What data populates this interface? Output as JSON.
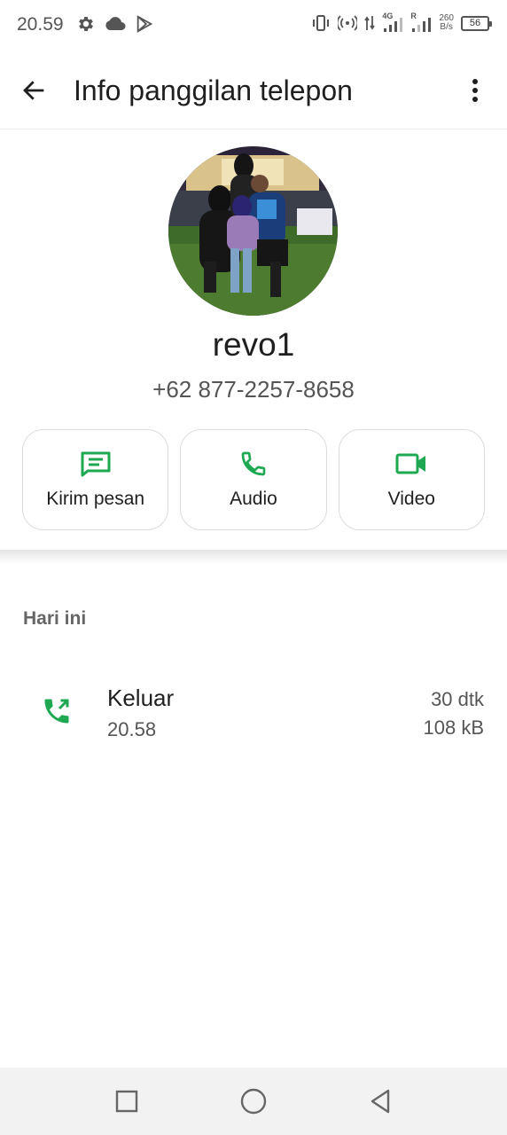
{
  "status_bar": {
    "time": "20.59",
    "network_type": "4G",
    "roaming": "R",
    "net_speed_value": "260",
    "net_speed_unit": "B/s",
    "battery": "56"
  },
  "app_bar": {
    "title": "Info panggilan telepon",
    "back_icon": "arrow-left-icon",
    "menu_icon": "more-vert-icon"
  },
  "contact": {
    "name": "revo1",
    "phone": "+62 877-2257-8658"
  },
  "actions": [
    {
      "label": "Kirim pesan",
      "icon": "message-icon"
    },
    {
      "label": "Audio",
      "icon": "phone-icon"
    },
    {
      "label": "Video",
      "icon": "videocam-icon"
    }
  ],
  "history": {
    "section_title": "Hari ini",
    "calls": [
      {
        "type": "Keluar",
        "time": "20.58",
        "duration": "30 dtk",
        "size": "108 kB",
        "icon": "outgoing-call-icon"
      }
    ]
  },
  "colors": {
    "accent": "#1DA851",
    "text_primary": "#1f1f1f",
    "text_secondary": "#555555"
  }
}
